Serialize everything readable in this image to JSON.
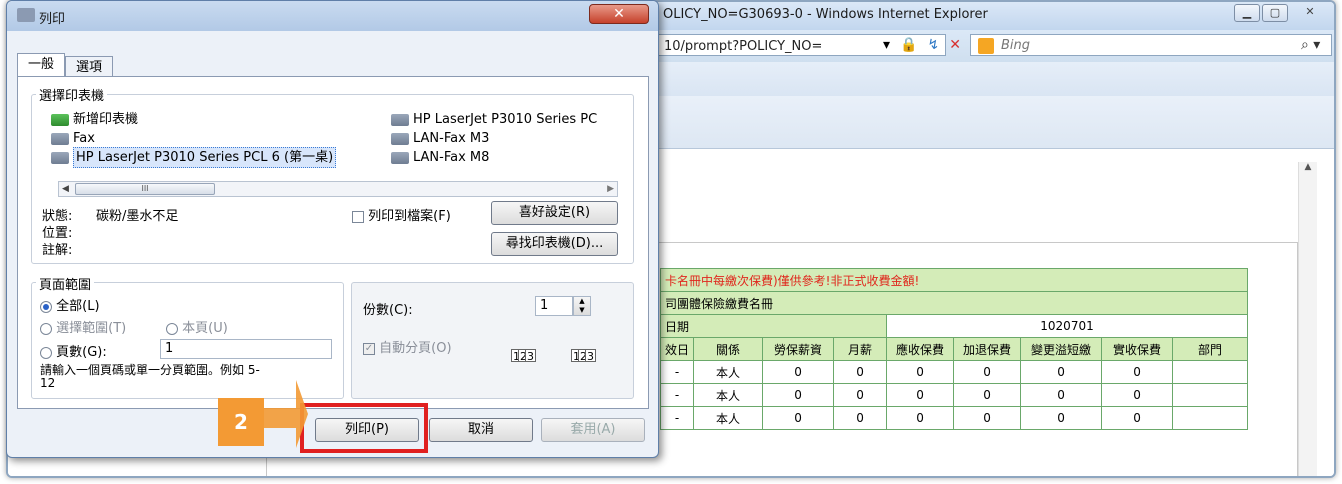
{
  "ie": {
    "title": "OLICY_NO=G30693-0 - Windows Internet Explorer",
    "address": "10/prompt?POLICY_NO=",
    "search_placeholder": "Bing"
  },
  "dialog": {
    "title": "列印",
    "tabs": [
      "一般",
      "選項"
    ],
    "select_printer_legend": "選擇印表機",
    "printers": [
      {
        "label": "新增印表機",
        "icon": "add-printer-icon"
      },
      {
        "label": "Fax",
        "icon": "printer-icon"
      },
      {
        "label": "HP LaserJet P3010 Series PCL 6 (第一桌)",
        "icon": "printer-icon",
        "selected": true
      },
      {
        "label": "HP LaserJet P3010 Series PC",
        "icon": "printer-icon"
      },
      {
        "label": "LAN-Fax M3",
        "icon": "printer-icon"
      },
      {
        "label": "LAN-Fax M8",
        "icon": "printer-icon"
      }
    ],
    "status_label": "狀態:",
    "status_value": "碳粉/墨水不足",
    "location_label": "位置:",
    "comment_label": "註解:",
    "print_to_file_label": "列印到檔案(F)",
    "preferences_button": "喜好設定(R)",
    "find_printer_button": "尋找印表機(D)...",
    "page_range_legend": "頁面範圍",
    "range_all": "全部(L)",
    "range_selection": "選擇範圍(T)",
    "range_current": "本頁(U)",
    "range_pages": "頁數(G):",
    "pages_value": "1",
    "range_hint": "請輸入一個頁碼或單一分頁範圍。例如 5-12",
    "copies_label": "份數(C):",
    "copies_value": "1",
    "collate_label": "自動分頁(O)",
    "print_button": "列印(P)",
    "cancel_button": "取消",
    "apply_button": "套用(A)"
  },
  "annotation": {
    "step_number": "2",
    "highlight_color": "#e02020",
    "badge_color": "#f39a34"
  },
  "report": {
    "warning": "卡名冊中每繳次保費)僅供參考!非正式收費金額!",
    "title": "司團體保險繳費名冊",
    "date_label": "日期",
    "date_value": "1020701",
    "headers": [
      "效日",
      "關係",
      "勞保薪資",
      "月薪",
      "應收保費",
      "加退保費",
      "變更溢短繳",
      "實收保費",
      "部門"
    ],
    "rows": [
      [
        "-",
        "本人",
        "0",
        "0",
        "0",
        "0",
        "0",
        "0",
        ""
      ],
      [
        "-",
        "本人",
        "0",
        "0",
        "0",
        "0",
        "0",
        "0",
        ""
      ],
      [
        "-",
        "本人",
        "0",
        "0",
        "0",
        "0",
        "0",
        "0",
        ""
      ]
    ]
  }
}
